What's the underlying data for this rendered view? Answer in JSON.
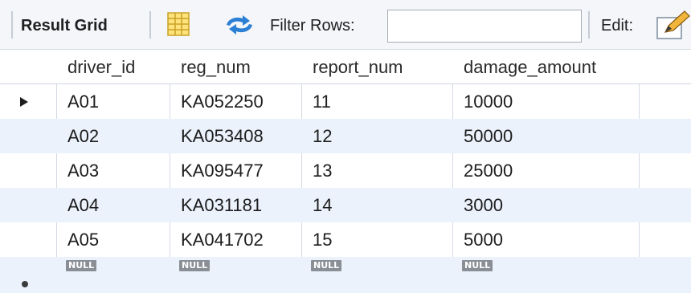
{
  "toolbar": {
    "result_grid_label": "Result Grid",
    "filter_label": "Filter Rows:",
    "filter_value": "",
    "edit_label": "Edit:"
  },
  "columns": [
    "driver_id",
    "reg_num",
    "report_num",
    "damage_amount"
  ],
  "rows": [
    [
      "A01",
      "KA052250",
      "11",
      "10000"
    ],
    [
      "A02",
      "KA053408",
      "12",
      "50000"
    ],
    [
      "A03",
      "KA095477",
      "13",
      "25000"
    ],
    [
      "A04",
      "KA031181",
      "14",
      "3000"
    ],
    [
      "A05",
      "KA041702",
      "15",
      "5000"
    ]
  ],
  "null_placeholder": "NULL",
  "colors": {
    "toolbar_bg": "#f4f6f9",
    "alt_row_bg": "#ebf2fc",
    "null_badge_bg": "#8a8f96",
    "refresh_icon": "#2b7fd4"
  },
  "icons": {
    "grid_view": "form-grid-icon",
    "refresh": "refresh-arrows-icon",
    "edit": "pencil-icon",
    "current_row": "row-pointer-icon",
    "new_row": "new-row-star-icon"
  }
}
